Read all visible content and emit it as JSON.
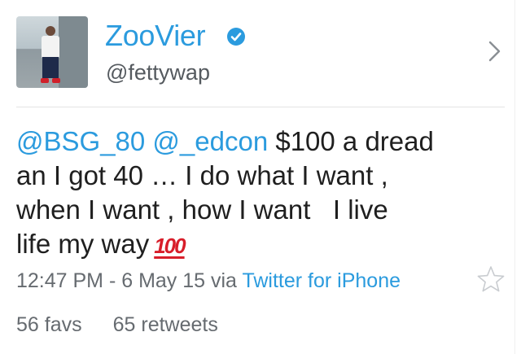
{
  "profile": {
    "display_name": "ZooVier",
    "handle": "@fettywap",
    "verified": true,
    "avatar_icon": "profile-photo"
  },
  "tweet": {
    "mention_1": "@BSG_80",
    "mention_2": "@_edcon",
    "text_line_1": " $100 a dread",
    "text_line_2": "an I got 40 … I do what I want ,",
    "text_line_3": "when I want , how I want   I live",
    "text_line_4": "life my way",
    "emoji": "100",
    "emoji_name": "hundred-points-emoji"
  },
  "meta": {
    "timestamp": "12:47 PM - 6 May 15 via",
    "source": "Twitter for iPhone"
  },
  "stats": {
    "favs": "56 favs",
    "retweets": "65 retweets"
  },
  "colors": {
    "link": "#2b9bde",
    "text": "#1f1f1f",
    "secondary": "#666b70",
    "emoji_red": "#d81e2a"
  },
  "icons": {
    "verified": "verified-badge-icon",
    "chevron": "chevron-right-icon",
    "favorite": "star-icon"
  }
}
